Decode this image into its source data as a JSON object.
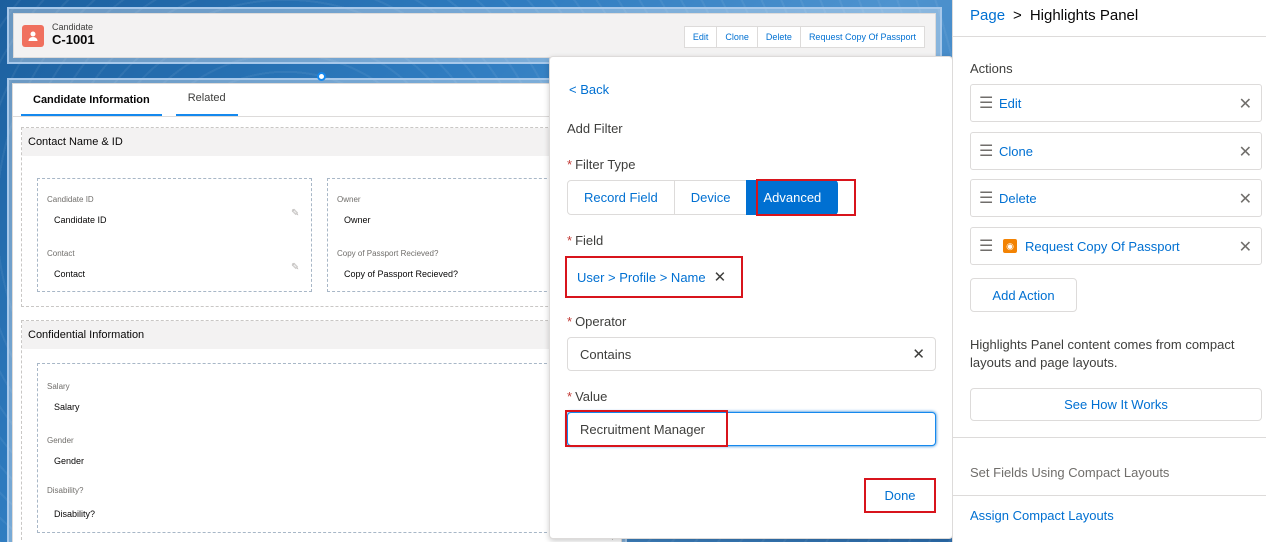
{
  "record": {
    "type_label": "Candidate",
    "name": "C-1001",
    "actions": [
      "Edit",
      "Clone",
      "Delete",
      "Request Copy Of Passport"
    ],
    "tabs": [
      "Candidate Information",
      "Related"
    ]
  },
  "sections": {
    "contact": {
      "title": "Contact Name & ID",
      "fields": [
        {
          "label": "Candidate ID",
          "value": "Candidate ID"
        },
        {
          "label": "Contact",
          "value": "Contact"
        },
        {
          "label": "Owner",
          "value": "Owner"
        },
        {
          "label": "Copy of Passport Recieved?",
          "value": "Copy of Passport Recieved?"
        }
      ]
    },
    "confidential": {
      "title": "Confidential Information",
      "fields": [
        {
          "label": "Salary",
          "value": "Salary"
        },
        {
          "label": "Gender",
          "value": "Gender"
        },
        {
          "label": "Disability?",
          "value": "Disability?"
        }
      ]
    }
  },
  "popover": {
    "back": "< Back",
    "title": "Add Filter",
    "filter_type_label": "Filter Type",
    "filter_types": [
      "Record Field",
      "Device",
      "Advanced"
    ],
    "selected_filter_type": "Advanced",
    "field_label": "Field",
    "field_value": "User > Profile > Name",
    "operator_label": "Operator",
    "operator_value": "Contains",
    "value_label": "Value",
    "value_value": "Recruitment Manager",
    "required_mark": "*",
    "done": "Done"
  },
  "panel": {
    "breadcrumb_root": "Page",
    "breadcrumb_sep": ">",
    "breadcrumb_current": "Highlights Panel",
    "actions_label": "Actions",
    "actions": [
      "Edit",
      "Clone",
      "Delete",
      "Request Copy Of Passport"
    ],
    "add_action": "Add Action",
    "help_text": "Highlights Panel content comes from compact layouts and page layouts.",
    "see_how": "See How It Works",
    "set_fields": "Set Fields Using Compact Layouts",
    "assign": "Assign Compact Layouts"
  },
  "colors": {
    "brand": "#0070d2",
    "highlight_border": "#d8141c",
    "required": "#c23934",
    "record_icon": "#f0705e"
  }
}
